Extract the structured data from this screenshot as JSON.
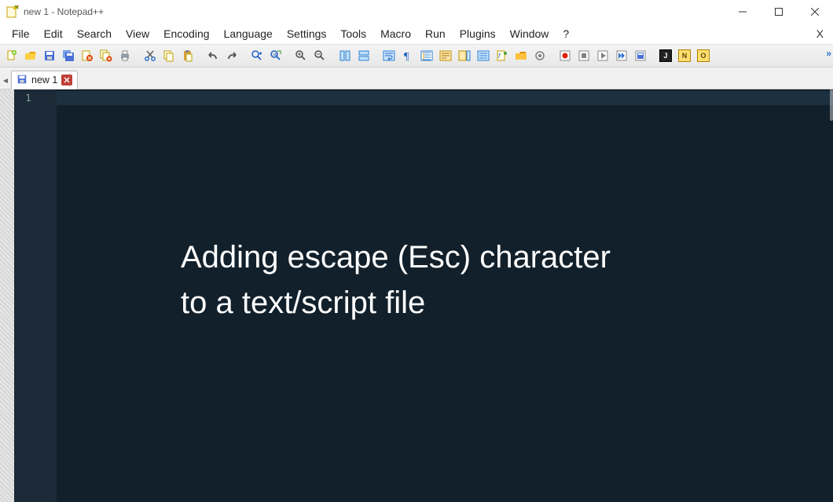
{
  "window": {
    "title": "new 1 - Notepad++"
  },
  "menu": {
    "items": [
      "File",
      "Edit",
      "Search",
      "View",
      "Encoding",
      "Language",
      "Settings",
      "Tools",
      "Macro",
      "Run",
      "Plugins",
      "Window",
      "?"
    ],
    "close_x": "X"
  },
  "toolbar": {
    "more": "»",
    "icons": [
      "new-file",
      "open-file",
      "save",
      "save-all",
      "close",
      "close-all",
      "print",
      "sep",
      "cut",
      "copy",
      "paste",
      "sep",
      "undo",
      "redo",
      "sep",
      "find",
      "replace",
      "sep",
      "zoom-in",
      "zoom-out",
      "sep",
      "sync-v",
      "sync-h",
      "sep",
      "wrap",
      "all-chars",
      "indent-guide",
      "lang-panel",
      "doc-map",
      "doc-list",
      "func-list",
      "folder",
      "monitor",
      "sep",
      "record",
      "stop",
      "play",
      "play-multi",
      "save-macro",
      "sep",
      "badge-J",
      "badge-N",
      "badge-O"
    ]
  },
  "tabs": {
    "arrow_left": "◄",
    "items": [
      {
        "label": "new 1",
        "dirty": false
      }
    ]
  },
  "editor": {
    "line_numbers": [
      "1"
    ],
    "overlay_line1": "Adding escape (Esc) character",
    "overlay_line2": "to a text/script file"
  }
}
